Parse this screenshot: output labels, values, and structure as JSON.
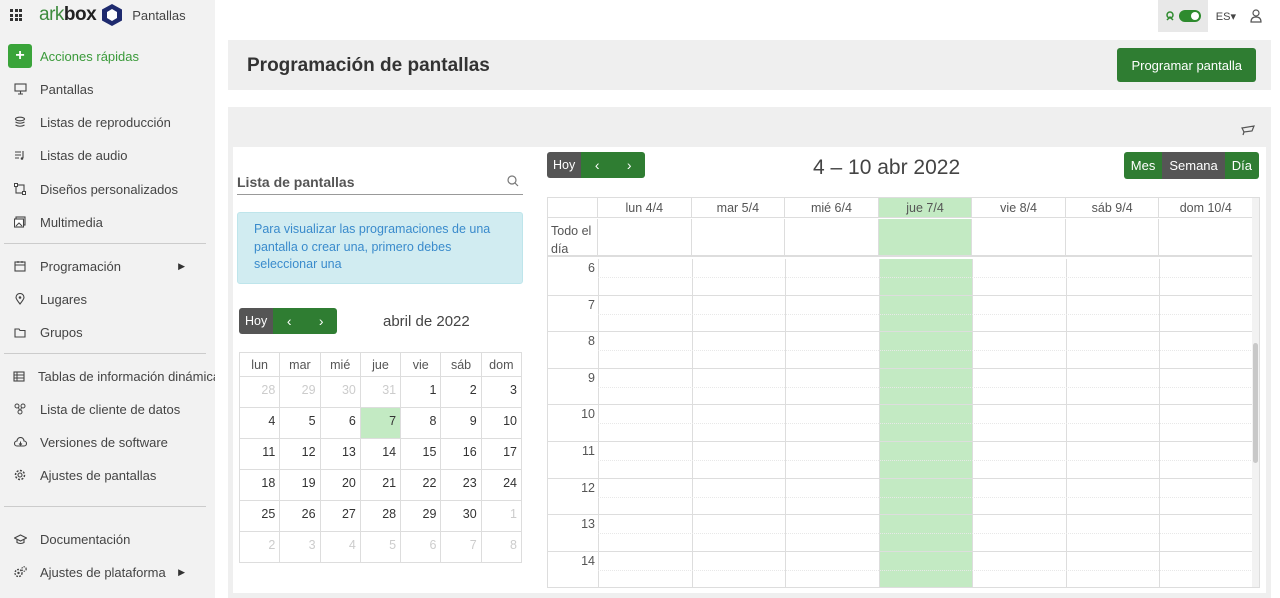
{
  "brand": {
    "logo_ark": "ark",
    "logo_box": "box",
    "app_name": "Pantallas"
  },
  "sidebar": {
    "quick_actions": "Acciones rápidas",
    "items": [
      {
        "label": "Pantallas",
        "icon": "monitor-icon"
      },
      {
        "label": "Listas de reproducción",
        "icon": "layers-icon"
      },
      {
        "label": "Listas de audio",
        "icon": "audio-list-icon"
      },
      {
        "label": "Diseños personalizados",
        "icon": "layout-icon"
      },
      {
        "label": "Multimedia",
        "icon": "media-icon"
      },
      {
        "label": "Programación",
        "icon": "calendar-icon",
        "submenu": true
      },
      {
        "label": "Lugares",
        "icon": "location-icon"
      },
      {
        "label": "Grupos",
        "icon": "folder-icon"
      },
      {
        "label": "Tablas de información dinámica",
        "icon": "table-icon"
      },
      {
        "label": "Lista de cliente de datos",
        "icon": "data-client-icon"
      },
      {
        "label": "Versiones de software",
        "icon": "cloud-download-icon"
      },
      {
        "label": "Ajustes de pantallas",
        "icon": "gear-icon"
      },
      {
        "label": "Documentación",
        "icon": "graduation-cap-icon"
      },
      {
        "label": "Ajustes de plataforma",
        "icon": "gears-icon",
        "submenu": true
      }
    ]
  },
  "topbar": {
    "language": "ES▾"
  },
  "header": {
    "title": "Programación de pantallas",
    "program_button": "Programar pantalla"
  },
  "screens": {
    "search_label": "Lista de pantallas",
    "info": "Para visualizar las programaciones de una pantalla o crear una, primero debes seleccionar una"
  },
  "mini_calendar": {
    "today_button": "Hoy",
    "title": "abril de 2022",
    "weekdays": [
      "lun",
      "mar",
      "mié",
      "jue",
      "vie",
      "sáb",
      "dom"
    ],
    "weeks": [
      [
        "28",
        "29",
        "30",
        "31",
        "1",
        "2",
        "3"
      ],
      [
        "4",
        "5",
        "6",
        "7",
        "8",
        "9",
        "10"
      ],
      [
        "11",
        "12",
        "13",
        "14",
        "15",
        "16",
        "17"
      ],
      [
        "18",
        "19",
        "20",
        "21",
        "22",
        "23",
        "24"
      ],
      [
        "25",
        "26",
        "27",
        "28",
        "29",
        "30",
        "1"
      ],
      [
        "2",
        "3",
        "4",
        "5",
        "6",
        "7",
        "8"
      ]
    ]
  },
  "week_calendar": {
    "today_button": "Hoy",
    "title": "4 – 10 abr 2022",
    "views": [
      "Mes",
      "Semana",
      "Día"
    ],
    "active_view": "Semana",
    "day_headers": [
      "lun 4/4",
      "mar 5/4",
      "mié 6/4",
      "jue 7/4",
      "vie 8/4",
      "sáb 9/4",
      "dom 10/4"
    ],
    "all_day_label": "Todo el día",
    "hours": [
      "6",
      "7",
      "8",
      "9",
      "10",
      "11",
      "12",
      "13",
      "14"
    ]
  },
  "colors": {
    "accent": "#2f7d32",
    "today": "#c3eac3",
    "info_bg": "#d1ecf1",
    "info_text": "#3a8bcc"
  }
}
